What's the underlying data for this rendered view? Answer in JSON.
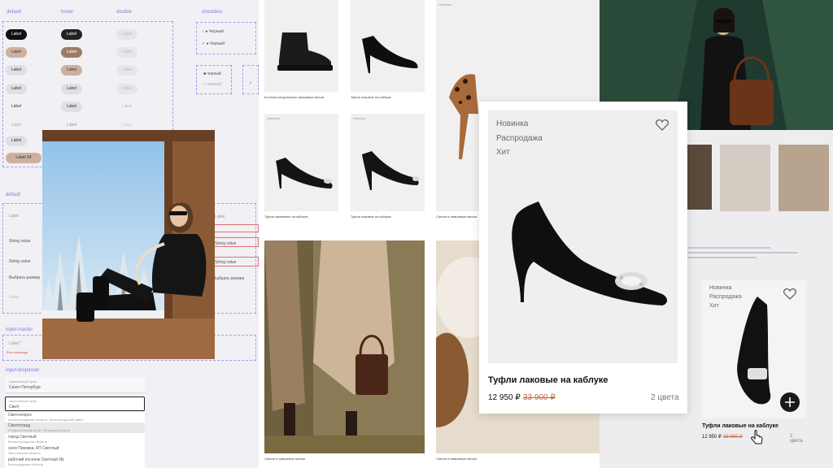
{
  "kit": {
    "headers": {
      "default": "default",
      "hover": "hover",
      "disable": "disable",
      "checkbox": "checkbox"
    },
    "chip_label": "Label",
    "chip_with_count": "Label",
    "chip_count": "24",
    "checkbox": {
      "option1": "Черный",
      "option2": "Черный",
      "option3": "черный",
      "option4": "черный"
    },
    "inputs": {
      "section_default": "default",
      "label": "Label",
      "value1": "String value",
      "value2": "String value",
      "select_size": "Выбрать размер"
    },
    "input_master": {
      "section": "input-master",
      "label": "Label *",
      "error": "Error message"
    },
    "dropdown": {
      "section": "input-dropdown",
      "field_label": "Населенный пункт",
      "field_value": "Санкт-Петербург",
      "search_label": "Населенный пункт",
      "search_value": "Свет|",
      "options": [
        {
          "title": "Светлогорск",
          "sub": "Калининградская область, Зеленоградский район"
        },
        {
          "title": "Светлоград",
          "sub": "Ставропольский край, Петровский район"
        },
        {
          "title": "город Светлый",
          "sub": "Калининградская область"
        },
        {
          "title": "село Пиковка, КП Светлый",
          "sub": "Ярославская область"
        },
        {
          "title": "рабочий поселок Светлый Яр",
          "sub": "Волгоградская область"
        }
      ]
    }
  },
  "catalog": {
    "captions": [
      "Ботинки натуральная замшевые мехом",
      "Туфли лаковые на каблуке",
      "Туфли замшевые на каблуке",
      "Туфли лаковые на каблуке",
      "Сапоги в замшевые мехом",
      "Сапоги в замшевые мехом",
      "Сапоги в замшевые мехом"
    ],
    "tags": [
      "Новинка",
      "Новинка",
      "Новинка"
    ]
  },
  "card": {
    "badges": [
      "Новинка",
      "Распродажа",
      "Хит"
    ],
    "name": "Туфли лаковые на каблуке",
    "price": "12 950 ₽",
    "old_price": "33 900 ₽",
    "colors": "2 цвета"
  },
  "card2": {
    "badges": [
      "Новинка",
      "Распродажа",
      "Хит"
    ],
    "name": "Туфли лаковые на каблуке",
    "price": "12 950 ₽",
    "old_price": "33 900 ₽",
    "colors": "2 цвета"
  },
  "icons": {
    "favorite": "heart-icon",
    "add": "plus-icon",
    "cursor": "hand-pointer-icon"
  },
  "colors": {
    "accent": "#8a78e0",
    "price_old": "#c26a4a",
    "chip_black": "#111111",
    "chip_beige": "#cdb19e",
    "chip_brown": "#9c7c63"
  }
}
